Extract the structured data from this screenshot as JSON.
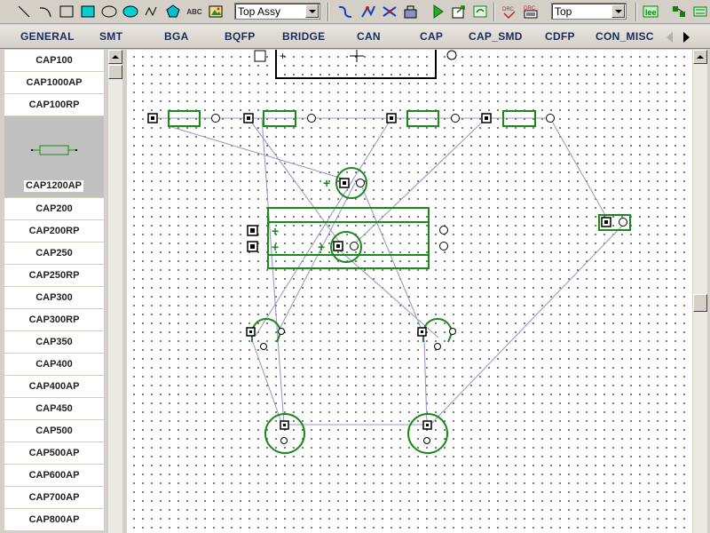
{
  "toolbar": {
    "tools": [
      "line-tool-icon",
      "arc-tool-icon",
      "rectangle-tool-icon",
      "filled-rectangle-tool-icon",
      "ellipse-tool-icon",
      "filled-ellipse-tool-icon",
      "polyline-tool-icon",
      "polygon-tool-icon",
      "text-tool-icon",
      "image-tool-icon"
    ],
    "text_tool_label": "ABC",
    "layer_select": {
      "value": "Top Assy"
    },
    "side_select": {
      "value": "Top"
    },
    "accent_color": "#22aa22"
  },
  "categories": {
    "tabs": [
      "GENERAL",
      "SMT",
      "BGA",
      "BQFP",
      "BRIDGE",
      "CAN",
      "CAP",
      "CAP_SMD",
      "CDFP",
      "CON_MISC"
    ]
  },
  "parts": {
    "items": [
      "CAP100",
      "CAP1000AP",
      "CAP100RP",
      "CAP1200AP",
      "CAP200",
      "CAP200RP",
      "CAP250",
      "CAP250RP",
      "CAP300",
      "CAP300RP",
      "CAP350",
      "CAP400",
      "CAP400AP",
      "CAP450",
      "CAP500",
      "CAP500AP",
      "CAP600AP",
      "CAP700AP",
      "CAP800AP"
    ],
    "selected": "CAP1200AP"
  },
  "canvas": {
    "component_color": "#1a8a1a",
    "ratsnest_color": "#9a9ac8",
    "grid_color": "#505050"
  }
}
